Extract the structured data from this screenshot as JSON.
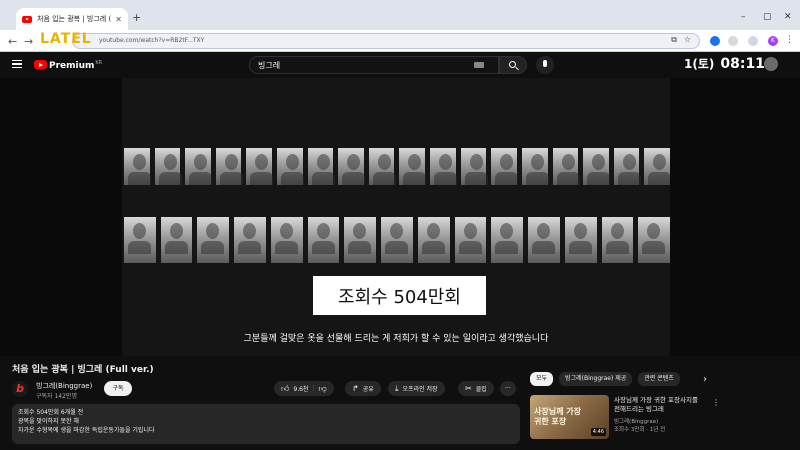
{
  "browser": {
    "tab_title": "처음 입는 광복 | 빙그레 (F",
    "tab_close": "✕",
    "new_tab": "+",
    "url": "youtube.com/watch?v=RB2tF...TXY",
    "overlay_logo": "LATEL",
    "window_controls": [
      "–",
      "▢",
      "✕"
    ],
    "profile_initial": "K"
  },
  "youtube": {
    "brand": "Premium",
    "brand_country": "KR",
    "search_value": "빙그레",
    "clock_date": "1(토)",
    "clock_time": "08:11"
  },
  "video": {
    "view_card": "조회수 504만회",
    "subtitle": "그분들께 걸맞은 옷을 선물해 드리는 게 저희가 할 수 있는 일이라고 생각했습니다",
    "portrait_rows": [
      18,
      15
    ]
  },
  "meta": {
    "title": "처음 입는 광복 | 빙그레 (Full ver.)",
    "channel_icon": "b",
    "channel_name": "빙그레(Binggrae)",
    "subscriber_count": "구독자 142만명",
    "subscribe_label": "구독",
    "like_count": "9.6천",
    "share_label": "공유",
    "offline_label": "오프라인 저장",
    "clip_label": "클립",
    "more_label": "···"
  },
  "description": {
    "line1": "조회수 504만회  6개월 전",
    "line2": "광복을 맞이하지 못한 채",
    "line3": "차가운 수형복에 생을 마감한 독립운동가들을 기립니다"
  },
  "sidebar": {
    "chips": [
      "모두",
      "빙그레(Binggrae) 제공",
      "관련 콘텐츠"
    ],
    "next": "›",
    "recommendation": {
      "thumb_text": "사장님께 가장\n귀한 포장",
      "duration": "4:46",
      "title": "사장님께 가장 귀한 포장사지를 전해드리는 빙그레",
      "channel": "빙그레(Binggrae)",
      "meta": "조회수 3만회 · 1년 전",
      "menu": "⋮"
    }
  }
}
